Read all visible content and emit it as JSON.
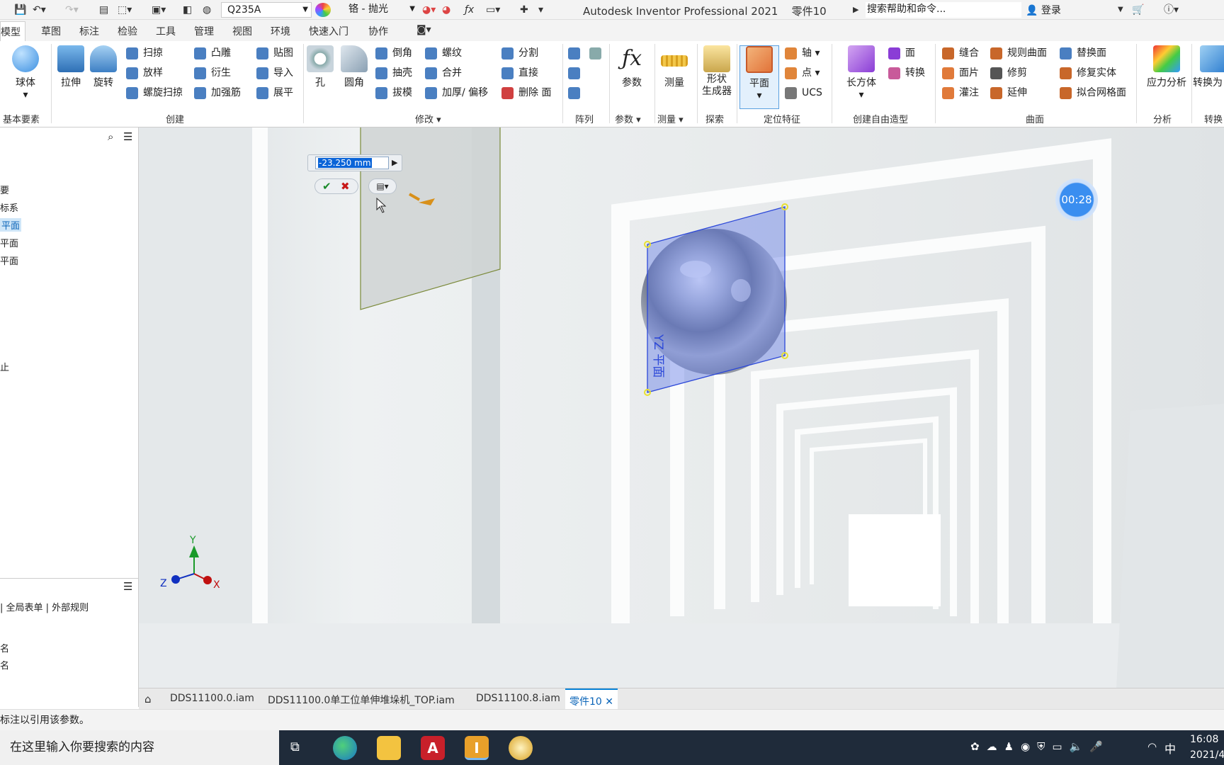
{
  "qat": {
    "material": "Q235A",
    "finish": "铬 - 抛光",
    "app_title": "Autodesk Inventor Professional 2021",
    "doc_title": "零件10",
    "search_placeholder": "搜索帮助和命令...",
    "login": "登录"
  },
  "tabs": [
    "草图",
    "标注",
    "检验",
    "工具",
    "管理",
    "视图",
    "环境",
    "快速入门",
    "协作"
  ],
  "active_tab": "模型",
  "ribbon": {
    "sphere": "球体",
    "basic_group": "基本要素",
    "extrude": "拉伸",
    "revolve": "旋转",
    "sweep": "扫掠",
    "loft": "放样",
    "coil": "螺旋扫掠",
    "emboss": "凸雕",
    "derive": "衍生",
    "rib": "加强筋",
    "decal": "贴图",
    "import": "导入",
    "unfold": "展平",
    "create_group": "创建",
    "hole": "孔",
    "fillet": "圆角",
    "chamfer": "倒角",
    "shell": "抽壳",
    "draft": "拔模",
    "thread": "螺纹",
    "combine": "合并",
    "thicken": "加厚/ 偏移",
    "split": "分割",
    "direct": "直接",
    "delete_face": "删除 面",
    "modify_group": "修改",
    "pattern_group": "阵列",
    "params": "参数",
    "params_group": "参数",
    "measure": "测量",
    "measure_group": "测量",
    "shape_gen": "形状\n生成器",
    "explore_group": "探索",
    "plane": "平面",
    "axis": "轴",
    "point": "点",
    "ucs": "UCS",
    "work_group": "定位特征",
    "box": "长方体",
    "face": "面",
    "convert": "转换",
    "freeform_group": "创建自由造型",
    "stitch": "缝合",
    "patch": "面片",
    "sculpt": "灌注",
    "ruled": "规则曲面",
    "trim": "修剪",
    "extend": "延伸",
    "replace": "替换面",
    "repair": "修复实体",
    "fit_mesh": "拟合网格面",
    "surface_group": "曲面",
    "stress": "应力分析",
    "analysis_group": "分析",
    "convert_to": "转换为",
    "convert_group": "转换"
  },
  "browser": {
    "items": [
      "原始坐标系",
      "平面",
      "平面",
      "平面"
    ],
    "item0": "要",
    "selected": "平面",
    "sub": "止"
  },
  "params_panel": {
    "tabs": "| 全局表单 | 外部规则",
    "rows": [
      "名",
      "名"
    ]
  },
  "dialog": {
    "value": "-23.250 mm"
  },
  "timer": "00:28",
  "plane_label": "YZ 平面",
  "triad": {
    "x": "X",
    "y": "Y",
    "z": "Z"
  },
  "doc_tabs": [
    "DDS11100.0.iam",
    "DDS11100.0单工位单伸堆垛机_TOP.iam",
    "DDS11100.8.iam",
    "零件10"
  ],
  "status": "标注以引用该参数。",
  "taskbar": {
    "search": "在这里输入你要搜索的内容",
    "ime": "中",
    "time": "16:08",
    "date": "2021/4"
  }
}
